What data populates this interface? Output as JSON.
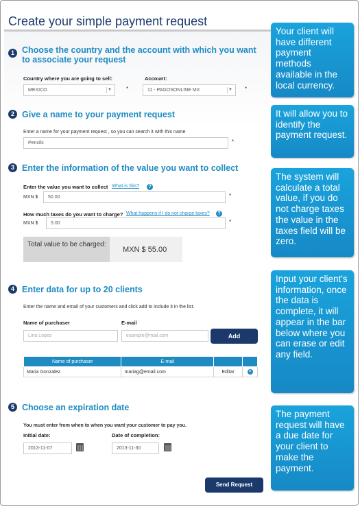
{
  "page_title": "Create your simple payment request",
  "step1": {
    "number": "1",
    "title": "Choose the country and the account with which you want to associate your request",
    "country_label": "Country where you are going to sell:",
    "country_value": "MEXICO",
    "account_label": "Account:",
    "account_value": "11 - PAGOSONLINE MX",
    "required_mark": "*"
  },
  "step2": {
    "number": "2",
    "title": "Give a name to your payment request",
    "name_label": "Enter a name for your payment request , so you can search it with this name",
    "name_value": "Pencils",
    "required_mark": "*"
  },
  "step3": {
    "number": "3",
    "title": "Enter the information of the value you want to collect",
    "value_label": "Enter the value you want to collect",
    "value_help_link": "What is this?",
    "value_currency": "MXN $",
    "value_amount": "50.00",
    "taxes_label": "How much taxes do you want to charge?",
    "taxes_help_link": "What happens if I do not charge taxes?",
    "taxes_currency": "MXN $",
    "taxes_amount": "5.00",
    "total_label": "Total value to be charged:",
    "total_value": "MXN $ 55.00",
    "help_glyph": "?",
    "required_mark": "*"
  },
  "step4": {
    "number": "4",
    "title": "Enter data for up to 20 clients",
    "instructions": "Enter the name and email of your customers and click add to include it in the list.",
    "purchaser_label": "Name of purchaser",
    "purchaser_placeholder": "Lina Lopez",
    "email_label": "E-mail",
    "email_placeholder": "example@mail.com",
    "add_button": "Add",
    "table_headers": [
      "Name of purchaser",
      "E-mail",
      "",
      ""
    ],
    "rows": [
      {
        "name": "Maria Gonzalez",
        "email": "mariag@email.com",
        "action": "Editar",
        "icon": "×"
      }
    ]
  },
  "step5": {
    "number": "5",
    "title": "Choose an expiration date",
    "instructions": "You must enter from when to when you want your customer to pay you.",
    "initial_label": "Initial date:",
    "initial_value": "2013-11-07",
    "completion_label": "Date of completion:",
    "completion_value": "2013-11-30"
  },
  "send_button": "Send Request",
  "callouts": [
    "Your client will have different payment methods available in the local currency.",
    "It will allow you to identify the payment request.",
    "The system will calculate a total value, if you do not charge taxes the value in the taxes field will be zero.",
    "Input your client's information, once the data is complete, it will appear in the bar below where you can erase or edit any field.",
    "The payment request will have a due date for your client to make the payment."
  ],
  "colors": {
    "accent": "#1e8bc3",
    "brand_dark": "#1b3a6b",
    "callout": "#1aa3dc"
  }
}
